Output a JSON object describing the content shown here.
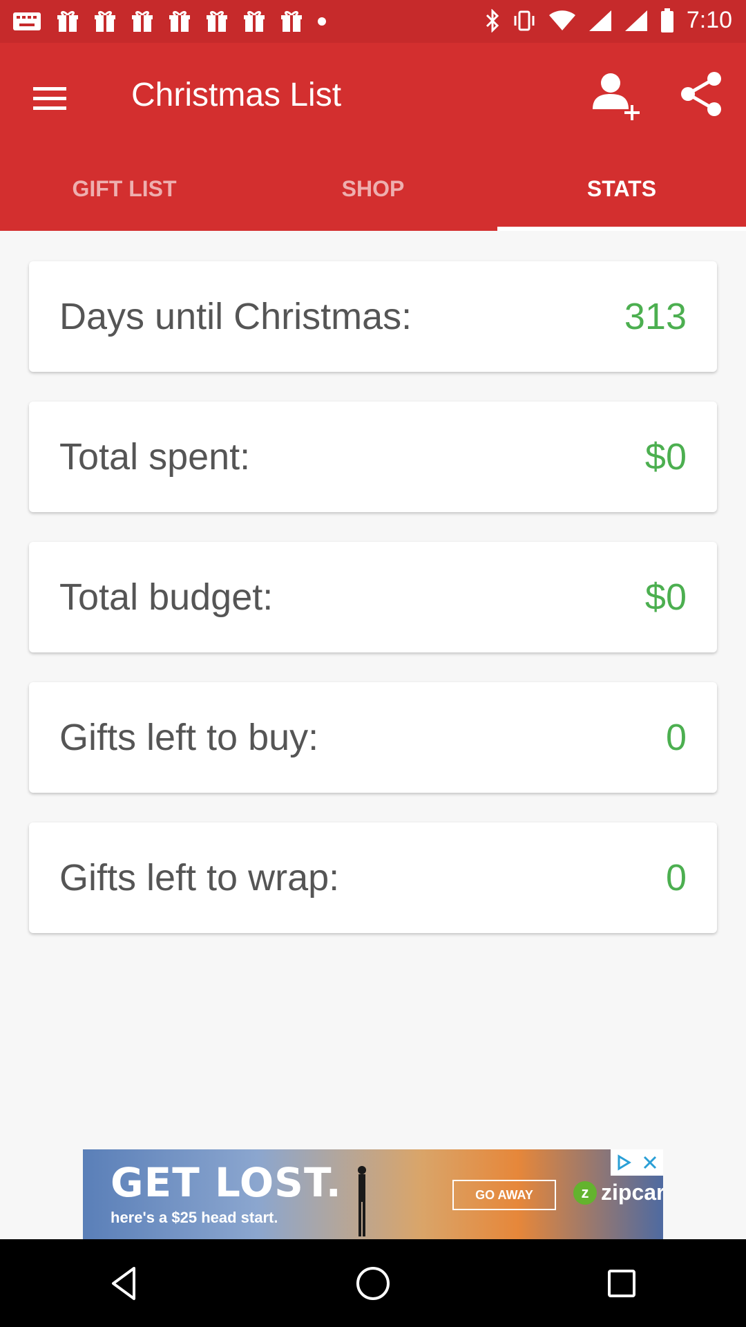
{
  "status_bar": {
    "time": "7:10"
  },
  "app_bar": {
    "title": "Christmas List",
    "icons": [
      "menu-icon",
      "add-person-icon",
      "share-icon"
    ]
  },
  "tabs": [
    {
      "label": "GIFT LIST",
      "active": false
    },
    {
      "label": "SHOP",
      "active": false
    },
    {
      "label": "STATS",
      "active": true
    }
  ],
  "stats": [
    {
      "label": "Days until Christmas:",
      "value": "313"
    },
    {
      "label": "Total spent:",
      "value": "$0"
    },
    {
      "label": "Total budget:",
      "value": "$0"
    },
    {
      "label": "Gifts left to buy:",
      "value": "0"
    },
    {
      "label": "Gifts left to wrap:",
      "value": "0"
    }
  ],
  "ad": {
    "headline": "GET LOST.",
    "subline": "here's a $25 head start.",
    "cta": "GO AWAY",
    "brand": "zipcar"
  },
  "colors": {
    "app_bar": "#d32f2f",
    "status_bar": "#c62a2b",
    "value_green": "#4caf50",
    "background": "#f7f7f7"
  }
}
